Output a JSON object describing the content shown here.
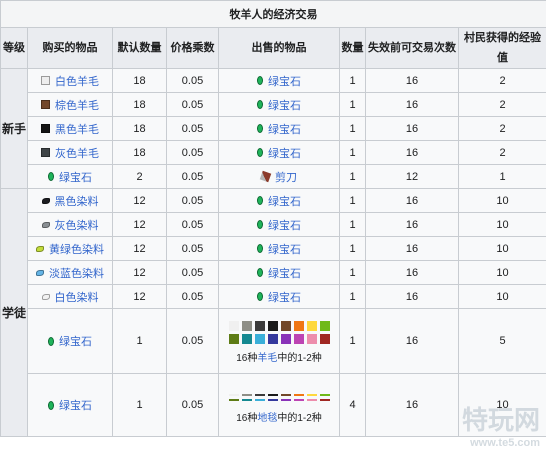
{
  "title": "牧羊人的经济交易",
  "headers": [
    "等级",
    "购买的物品",
    "默认数量",
    "价格乘数",
    "出售的物品",
    "数量",
    "失效前可交易次数",
    "村民获得的经验值"
  ],
  "stages": {
    "novice": "新手",
    "apprentice": "学徒"
  },
  "novice_rows": [
    {
      "buy": "白色羊毛",
      "buy_icon": "white-wool-icon",
      "qty": "18",
      "mult": "0.05",
      "sell": "绿宝石",
      "sell_icon": "emerald-icon",
      "sell_qty": "1",
      "uses": "16",
      "xp": "2"
    },
    {
      "buy": "棕色羊毛",
      "buy_icon": "brown-wool-icon",
      "qty": "18",
      "mult": "0.05",
      "sell": "绿宝石",
      "sell_icon": "emerald-icon",
      "sell_qty": "1",
      "uses": "16",
      "xp": "2"
    },
    {
      "buy": "黑色羊毛",
      "buy_icon": "black-wool-icon",
      "qty": "18",
      "mult": "0.05",
      "sell": "绿宝石",
      "sell_icon": "emerald-icon",
      "sell_qty": "1",
      "uses": "16",
      "xp": "2"
    },
    {
      "buy": "灰色羊毛",
      "buy_icon": "gray-wool-icon",
      "qty": "18",
      "mult": "0.05",
      "sell": "绿宝石",
      "sell_icon": "emerald-icon",
      "sell_qty": "1",
      "uses": "16",
      "xp": "2"
    },
    {
      "buy": "绿宝石",
      "buy_icon": "emerald-icon",
      "qty": "2",
      "mult": "0.05",
      "sell": "剪刀",
      "sell_icon": "shears-icon",
      "sell_qty": "1",
      "uses": "12",
      "xp": "1"
    }
  ],
  "apprentice_rows": [
    {
      "buy": "黑色染料",
      "buy_icon": "black-dye-icon",
      "qty": "12",
      "mult": "0.05",
      "sell": "绿宝石",
      "sell_icon": "emerald-icon",
      "sell_qty": "1",
      "uses": "16",
      "xp": "10"
    },
    {
      "buy": "灰色染料",
      "buy_icon": "gray-dye-icon",
      "qty": "12",
      "mult": "0.05",
      "sell": "绿宝石",
      "sell_icon": "emerald-icon",
      "sell_qty": "1",
      "uses": "16",
      "xp": "10"
    },
    {
      "buy": "黄绿色染料",
      "buy_icon": "lime-dye-icon",
      "qty": "12",
      "mult": "0.05",
      "sell": "绿宝石",
      "sell_icon": "emerald-icon",
      "sell_qty": "1",
      "uses": "16",
      "xp": "10"
    },
    {
      "buy": "淡蓝色染料",
      "buy_icon": "light-blue-dye-icon",
      "qty": "12",
      "mult": "0.05",
      "sell": "绿宝石",
      "sell_icon": "emerald-icon",
      "sell_qty": "1",
      "uses": "16",
      "xp": "10"
    },
    {
      "buy": "白色染料",
      "buy_icon": "white-dye-icon",
      "qty": "12",
      "mult": "0.05",
      "sell": "绿宝石",
      "sell_icon": "emerald-icon",
      "sell_qty": "1",
      "uses": "16",
      "xp": "10"
    },
    {
      "buy": "绿宝石",
      "buy_icon": "emerald-icon",
      "qty": "1",
      "mult": "0.05",
      "sell_note_prefix": "16种",
      "sell_link": "羊毛",
      "sell_note_suffix": "中的1-2种",
      "sell_qty": "1",
      "uses": "16",
      "xp": "5"
    },
    {
      "buy": "绿宝石",
      "buy_icon": "emerald-icon",
      "qty": "1",
      "mult": "0.05",
      "sell_note_prefix": "16种",
      "sell_link": "地毯",
      "sell_note_suffix": "中的1-2种",
      "sell_qty": "4",
      "uses": "16",
      "xp": "10"
    }
  ],
  "colors": {
    "white-wool": "#eeeeee",
    "brown-wool": "#72472a",
    "black-wool": "#141414",
    "gray-wool": "#3e4447",
    "black-dye": "#1d1d21",
    "gray-dye": "#8a8f93",
    "lime-dye": "#c2dc3a",
    "light-blue-dye": "#64b4e6",
    "white-dye": "#f2f2f2",
    "palette": [
      "#f0f0f0",
      "#8e8e86",
      "#3b3b3b",
      "#1a1a1a",
      "#724728",
      "#f07613",
      "#fed83d",
      "#70b919",
      "#5e7c16",
      "#158991",
      "#3aafd9",
      "#35399d",
      "#8932b8",
      "#bd44b3",
      "#ed8dac",
      "#a02722"
    ]
  },
  "watermark": {
    "brand": "特玩网",
    "site": "www.te5.com"
  }
}
